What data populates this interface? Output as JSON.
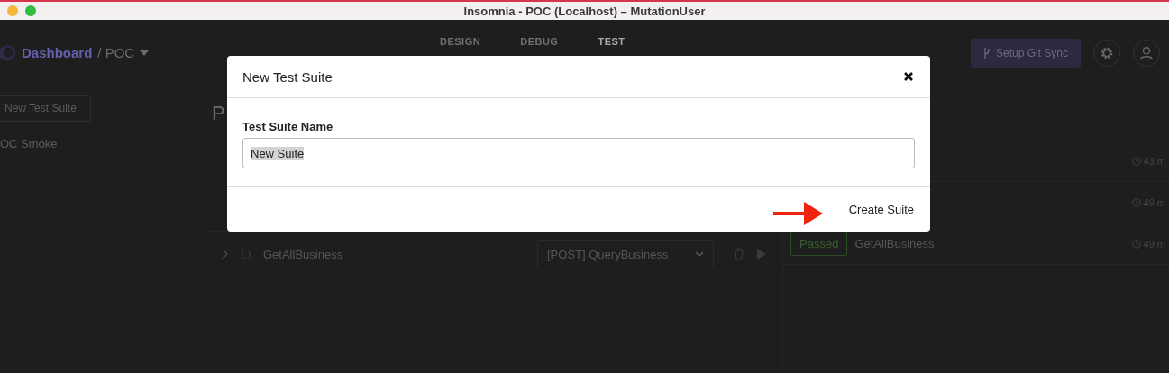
{
  "window": {
    "title": "Insomnia - POC (Localhost) – MutationUser"
  },
  "header": {
    "dashboard": "Dashboard",
    "project": "/ POC",
    "git_button": "Setup Git Sync",
    "tabs": [
      {
        "label": "DESIGN",
        "selected": false
      },
      {
        "label": "DEBUG",
        "selected": false
      },
      {
        "label": "TEST",
        "selected": true
      }
    ]
  },
  "sidebar": {
    "new_button": "New Test Suite",
    "suites": [
      "OC Smoke"
    ]
  },
  "panel": {
    "heading": "P",
    "tests": [
      {
        "name": "GetAllBusiness",
        "request": "[POST] QueryBusiness"
      }
    ]
  },
  "results": [
    {
      "time": "43 m"
    },
    {
      "time": "49 m"
    },
    {
      "status": "Passed",
      "name": "GetAllBusiness",
      "time": "49 m"
    }
  ],
  "modal": {
    "title": "New Test Suite",
    "field_label": "Test Suite Name",
    "field_value": "New Suite",
    "value_selected": true,
    "submit": "Create Suite"
  }
}
